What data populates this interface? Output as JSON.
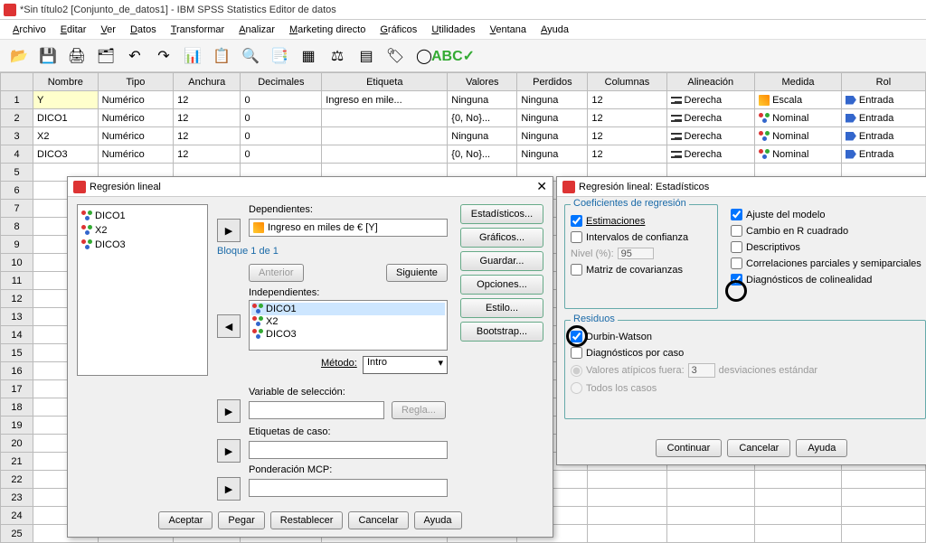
{
  "titlebar": {
    "text": "*Sin título2 [Conjunto_de_datos1] - IBM SPSS Statistics Editor de datos"
  },
  "menubar": [
    "Archivo",
    "Editar",
    "Ver",
    "Datos",
    "Transformar",
    "Analizar",
    "Marketing directo",
    "Gráficos",
    "Utilidades",
    "Ventana",
    "Ayuda"
  ],
  "grid": {
    "headers": [
      "Nombre",
      "Tipo",
      "Anchura",
      "Decimales",
      "Etiqueta",
      "Valores",
      "Perdidos",
      "Columnas",
      "Alineación",
      "Medida",
      "Rol"
    ],
    "rows": [
      {
        "num": "1",
        "nombre": "Y",
        "tipo": "Numérico",
        "anchura": "12",
        "dec": "0",
        "etiqueta": "Ingreso en mile...",
        "valores": "Ninguna",
        "perdidos": "Ninguna",
        "col": "12",
        "align": "Derecha",
        "medida": "Escala",
        "medida_icon": "scale",
        "rol": "Entrada"
      },
      {
        "num": "2",
        "nombre": "DICO1",
        "tipo": "Numérico",
        "anchura": "12",
        "dec": "0",
        "etiqueta": "",
        "valores": "{0, No}...",
        "perdidos": "Ninguna",
        "col": "12",
        "align": "Derecha",
        "medida": "Nominal",
        "medida_icon": "nominal",
        "rol": "Entrada"
      },
      {
        "num": "3",
        "nombre": "X2",
        "tipo": "Numérico",
        "anchura": "12",
        "dec": "0",
        "etiqueta": "",
        "valores": "Ninguna",
        "perdidos": "Ninguna",
        "col": "12",
        "align": "Derecha",
        "medida": "Nominal",
        "medida_icon": "nominal",
        "rol": "Entrada"
      },
      {
        "num": "4",
        "nombre": "DICO3",
        "tipo": "Numérico",
        "anchura": "12",
        "dec": "0",
        "etiqueta": "",
        "valores": "{0, No}...",
        "perdidos": "Ninguna",
        "col": "12",
        "align": "Derecha",
        "medida": "Nominal",
        "medida_icon": "nominal",
        "rol": "Entrada"
      }
    ],
    "empty_rows": 21
  },
  "dlg1": {
    "title": "Regresión lineal",
    "vars": [
      "DICO1",
      "X2",
      "DICO3"
    ],
    "dep_label": "Dependientes:",
    "dep_value": "Ingreso en miles de € [Y]",
    "block": "Bloque 1 de 1",
    "anterior": "Anterior",
    "siguiente": "Siguiente",
    "indep_label": "Independientes:",
    "indeps": [
      "DICO1",
      "X2",
      "DICO3"
    ],
    "metodo_label": "Método:",
    "metodo_value": "Intro",
    "sel_label": "Variable de selección:",
    "regla": "Regla...",
    "caso_label": "Etiquetas de caso:",
    "mcp_label": "Ponderación MCP:",
    "side": [
      "Estadísticos...",
      "Gráficos...",
      "Guardar...",
      "Opciones...",
      "Estilo...",
      "Bootstrap..."
    ],
    "bottom": [
      "Aceptar",
      "Pegar",
      "Restablecer",
      "Cancelar",
      "Ayuda"
    ]
  },
  "dlg2": {
    "title": "Regresión lineal: Estadísticos",
    "coef": {
      "legend": "Coeficientes de regresión",
      "estimaciones": "Estimaciones",
      "ic": "Intervalos de confianza",
      "nivel_label": "Nivel (%):",
      "nivel_value": "95",
      "mcov": "Matriz de covarianzas"
    },
    "right": {
      "ajuste": "Ajuste del modelo",
      "r2": "Cambio en R cuadrado",
      "desc": "Descriptivos",
      "corr": "Correlaciones parciales y semiparciales",
      "colin": "Diagnósticos de colinealidad"
    },
    "resid": {
      "legend": "Residuos",
      "dw": "Durbin-Watson",
      "diag": "Diagnósticos por caso",
      "outlier": "Valores atípicos fuera:",
      "outlier_val": "3",
      "outlier_suffix": "desviaciones estándar",
      "todos": "Todos los casos"
    },
    "bottom": [
      "Continuar",
      "Cancelar",
      "Ayuda"
    ]
  }
}
